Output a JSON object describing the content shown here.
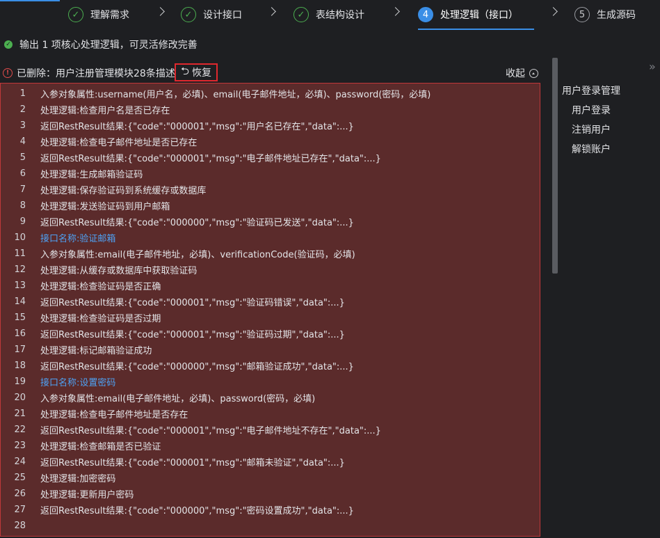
{
  "steps": [
    {
      "num": "✓",
      "label": "理解需求"
    },
    {
      "num": "✓",
      "label": "设计接口"
    },
    {
      "num": "✓",
      "label": "表结构设计"
    },
    {
      "num": "4",
      "label": "处理逻辑（接口）"
    },
    {
      "num": "5",
      "label": "生成源码"
    }
  ],
  "status": {
    "icon": "✓",
    "text": "输出 1 项核心处理逻辑，可灵活修改完善"
  },
  "deletion": {
    "icon": "!",
    "text": "已删除：用户注册管理模块28条描述",
    "restore_icon": "⮌",
    "restore_label": "恢复",
    "collapse_label": "收起"
  },
  "code_lines": [
    {
      "n": "1",
      "text": "入参对象属性:username(用户名，必填)、email(电子邮件地址，必填)、password(密码，必填)"
    },
    {
      "n": "2",
      "text": "处理逻辑:检查用户名是否已存在"
    },
    {
      "n": "3",
      "text": "返回RestResult结果:{\"code\":\"000001\",\"msg\":\"用户名已存在\",\"data\":...}"
    },
    {
      "n": "4",
      "text": "处理逻辑:检查电子邮件地址是否已存在"
    },
    {
      "n": "5",
      "text": "返回RestResult结果:{\"code\":\"000001\",\"msg\":\"电子邮件地址已存在\",\"data\":...}"
    },
    {
      "n": "6",
      "text": "处理逻辑:生成邮箱验证码"
    },
    {
      "n": "7",
      "text": "处理逻辑:保存验证码到系统缓存或数据库"
    },
    {
      "n": "8",
      "text": "处理逻辑:发送验证码到用户邮箱"
    },
    {
      "n": "9",
      "text": "返回RestResult结果:{\"code\":\"000000\",\"msg\":\"验证码已发送\",\"data\":...}"
    },
    {
      "n": "10",
      "text": "接口名称:验证邮箱",
      "iface": true
    },
    {
      "n": "11",
      "text": "入参对象属性:email(电子邮件地址，必填)、verificationCode(验证码，必填)"
    },
    {
      "n": "12",
      "text": "处理逻辑:从缓存或数据库中获取验证码"
    },
    {
      "n": "13",
      "text": "处理逻辑:检查验证码是否正确"
    },
    {
      "n": "14",
      "text": "返回RestResult结果:{\"code\":\"000001\",\"msg\":\"验证码错误\",\"data\":...}"
    },
    {
      "n": "15",
      "text": "处理逻辑:检查验证码是否过期"
    },
    {
      "n": "16",
      "text": "返回RestResult结果:{\"code\":\"000001\",\"msg\":\"验证码过期\",\"data\":...}"
    },
    {
      "n": "17",
      "text": "处理逻辑:标记邮箱验证成功"
    },
    {
      "n": "18",
      "text": "返回RestResult结果:{\"code\":\"000000\",\"msg\":\"邮箱验证成功\",\"data\":...}"
    },
    {
      "n": "19",
      "text": "接口名称:设置密码",
      "iface": true
    },
    {
      "n": "20",
      "text": "入参对象属性:email(电子邮件地址，必填)、password(密码，必填)"
    },
    {
      "n": "21",
      "text": "处理逻辑:检查电子邮件地址是否存在"
    },
    {
      "n": "22",
      "text": "返回RestResult结果:{\"code\":\"000001\",\"msg\":\"电子邮件地址不存在\",\"data\":...}"
    },
    {
      "n": "23",
      "text": "处理逻辑:检查邮箱是否已验证"
    },
    {
      "n": "24",
      "text": "返回RestResult结果:{\"code\":\"000001\",\"msg\":\"邮箱未验证\",\"data\":...}"
    },
    {
      "n": "25",
      "text": "处理逻辑:加密密码"
    },
    {
      "n": "26",
      "text": "处理逻辑:更新用户密码"
    },
    {
      "n": "27",
      "text": "返回RestResult结果:{\"code\":\"000000\",\"msg\":\"密码设置成功\",\"data\":...}"
    },
    {
      "n": "28",
      "text": ""
    }
  ],
  "outline": {
    "title": "用户登录管理",
    "items": [
      "用户登录",
      "注销用户",
      "解锁账户"
    ]
  },
  "expand_icon": "»"
}
